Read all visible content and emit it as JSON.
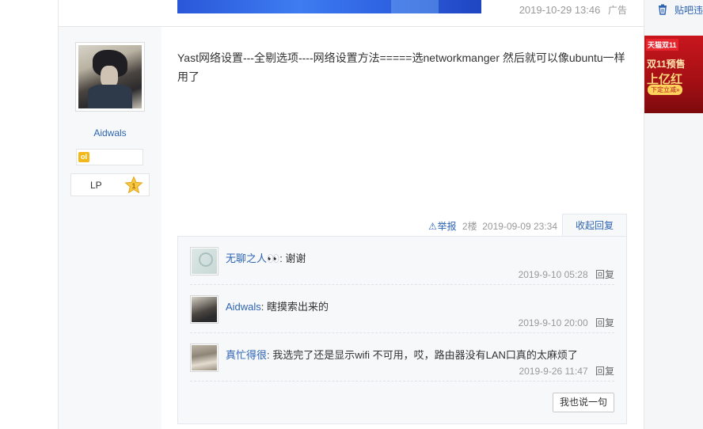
{
  "ad": {
    "timestamp": "2019-10-29 13:46",
    "label": "广告"
  },
  "author": {
    "name": "Aidwals",
    "badge_icon": "ol",
    "level_name": "LP",
    "level_number": "1"
  },
  "post": {
    "content": "Yast网络设置---全剔选项----网络设置方法=====选networkmanger 然后就可以像ubuntu一样用了",
    "report_label": "举报",
    "floor": "2楼",
    "time": "2019-09-09 23:34",
    "fold_reply_label": "收起回复"
  },
  "replies": [
    {
      "user": "无聊之人👀",
      "text": "谢谢",
      "time": "2019-9-10 05:28",
      "reply_label": "回复",
      "avatar": "default-avatar-icon"
    },
    {
      "user": "Aidwals",
      "text": "瞎摸索出来的",
      "time": "2019-9-10 20:00",
      "reply_label": "回复",
      "avatar": "anime-avatar"
    },
    {
      "user": "真忙得很",
      "text": "我选完了还是显示wifi 不可用，哎，路由器没有LAN口真的太麻烦了",
      "time": "2019-9-26 11:47",
      "reply_label": "回复",
      "avatar": "book-avatar"
    }
  ],
  "say_button": "我也说一句",
  "rail": {
    "link_label": "贴吧违",
    "ad_brand": "天猫双11",
    "ad_line1": "双11预售",
    "ad_line2": "上亿红",
    "ad_cta": "下定立减»"
  },
  "colors": {
    "link": "#2d64b3",
    "meta": "#999999",
    "panel": "#f7f8fa"
  }
}
